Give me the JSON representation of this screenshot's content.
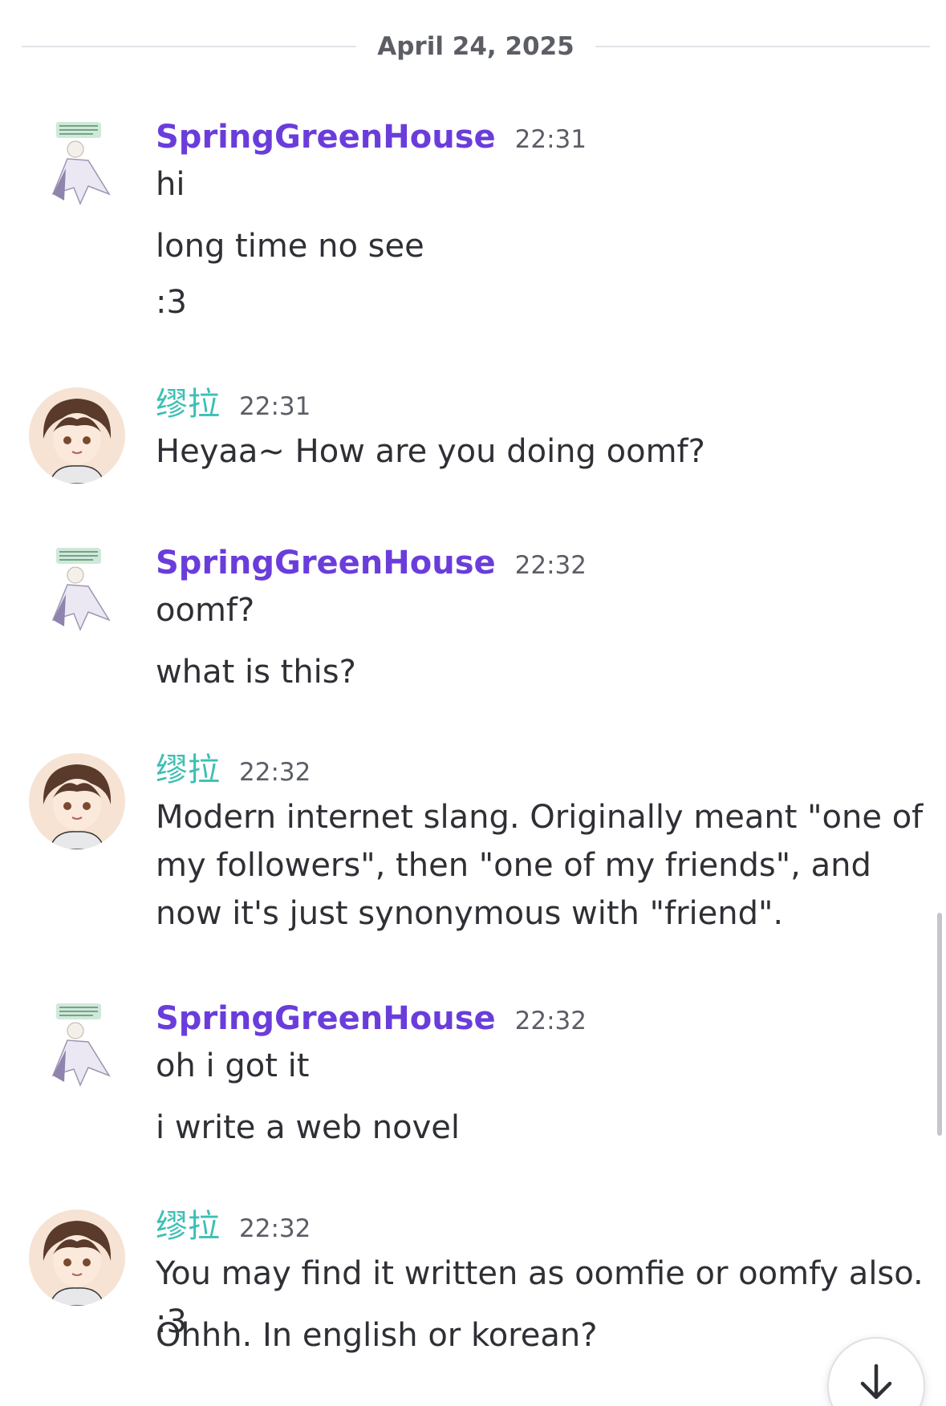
{
  "date_divider": "April 24, 2025",
  "colors": {
    "springgreenhouse_name": "#6a3ddb",
    "mira_name": "#3dbfb3",
    "text": "#2e3035",
    "muted": "#5c5e66"
  },
  "messages": [
    {
      "author": "SpringGreenHouse",
      "time": "22:31",
      "avatar_icon": "anime-character-avatar",
      "lines": [
        "hi",
        "long time no see",
        ":3"
      ]
    },
    {
      "author": "缪拉",
      "time": "22:31",
      "avatar_icon": "anime-girl-avatar",
      "lines": [
        "Heyaa~ How are you doing oomf?"
      ]
    },
    {
      "author": "SpringGreenHouse",
      "time": "22:32",
      "avatar_icon": "anime-character-avatar",
      "lines": [
        "oomf?",
        "what is this?"
      ]
    },
    {
      "author": "缪拉",
      "time": "22:32",
      "avatar_icon": "anime-girl-avatar",
      "lines": [
        "Modern internet slang. Originally meant \"one of my followers\", then \"one of my friends\", and now it's just synonymous with \"friend\"."
      ]
    },
    {
      "author": "SpringGreenHouse",
      "time": "22:32",
      "avatar_icon": "anime-character-avatar",
      "lines": [
        "oh i got it",
        "i write a web novel"
      ]
    },
    {
      "author": "缪拉",
      "time": "22:32",
      "avatar_icon": "anime-girl-avatar",
      "lines": [
        "You may find it written as oomfie or oomfy also. :3",
        "Ohhh. In english or korean?"
      ]
    }
  ],
  "jump_to_present_icon": "arrow-down-icon"
}
